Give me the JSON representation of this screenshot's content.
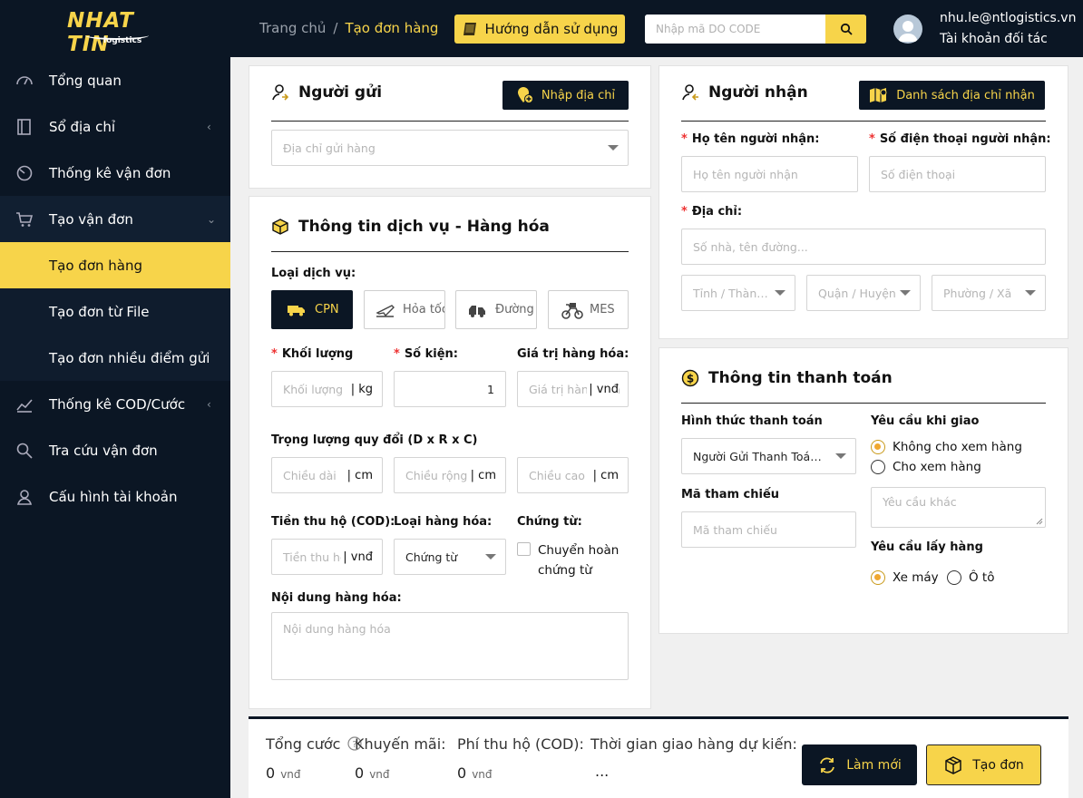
{
  "logo": {
    "brand": "NHAT TIN",
    "sub": "logistics"
  },
  "breadcrumb": {
    "home": "Trang chủ",
    "sep": "/",
    "current": "Tạo đơn hàng"
  },
  "header": {
    "guide_label": "Hướng dẫn sử dụng",
    "search_placeholder": "Nhập mã DO CODE",
    "user_email": "nhu.le@ntlogistics.vn",
    "user_role": "Tài khoản đối tác"
  },
  "sidebar": {
    "items": [
      {
        "label": "Tổng quan",
        "icon": "dashboard-icon"
      },
      {
        "label": "Sổ địa chỉ",
        "icon": "address-book-icon",
        "chevron": "‹"
      },
      {
        "label": "Thống kê vận đơn",
        "icon": "stats-icon"
      },
      {
        "label": "Tạo vận đơn",
        "icon": "cart-icon",
        "chevron": "⌄"
      },
      {
        "label": "Tạo đơn hàng"
      },
      {
        "label": "Tạo đơn từ File"
      },
      {
        "label": "Tạo đơn nhiều điểm gửi"
      },
      {
        "label": "Thống kê COD/Cước",
        "icon": "chart-icon",
        "chevron": "‹"
      },
      {
        "label": "Tra cứu vận đơn",
        "icon": "search-icon"
      },
      {
        "label": "Cấu hình tài khoản",
        "icon": "user-icon"
      }
    ]
  },
  "sender": {
    "title": "Người gửi",
    "button": "Nhập địa chỉ",
    "address_placeholder": "Địa chỉ gửi hàng"
  },
  "service": {
    "title": "Thông tin dịch vụ - Hàng hóa",
    "type_label": "Loại dịch vụ:",
    "options": [
      "CPN",
      "Hỏa tốc",
      "Đường bộ",
      "MES"
    ],
    "weight_label": "Khối lượng",
    "weight_placeholder": "Khối lượng",
    "weight_unit": "| kg",
    "packages_label": "Số kiện:",
    "packages_value": "1",
    "goods_value_label": "Giá trị hàng hóa:",
    "goods_value_placeholder": "Giá trị hàng hóa",
    "currency_unit": "| vnđ",
    "dim_label": "Trọng lượng quy đổi (D x R x C)",
    "length_placeholder": "Chiều dài",
    "width_placeholder": "Chiều rộng",
    "height_placeholder": "Chiều cao",
    "cm_unit": "| cm",
    "cod_label": "Tiền thu hộ (COD):",
    "cod_placeholder": "Tiền thu hộ",
    "goods_type_label": "Loại hàng hóa:",
    "goods_type_value": "Chứng từ",
    "docs_label": "Chứng từ:",
    "docs_check": "Chuyển hoàn chứng từ",
    "content_label": "Nội dung hàng hóa:",
    "content_placeholder": "Nội dung hàng hóa"
  },
  "receiver": {
    "title": "Người nhận",
    "button": "Danh sách địa chỉ nhận",
    "name_label": "Họ tên người nhận:",
    "name_placeholder": "Họ tên người nhận",
    "phone_label": "Số điện thoại người nhận:",
    "phone_placeholder": "Số điện thoại",
    "address_label": "Địa chỉ:",
    "address_placeholder": "Số nhà, tên đường...",
    "province": "Tỉnh / Thành phố",
    "district": "Quận / Huyện",
    "ward": "Phường / Xã"
  },
  "payment": {
    "title": "Thông tin thanh toán",
    "method_label": "Hình thức thanh toán",
    "method_value": "Người Gửi Thanh Toán Ngay",
    "ref_label": "Mã tham chiếu",
    "ref_placeholder": "Mã tham chiếu",
    "delivery_label": "Yêu cầu khi giao",
    "delivery_opt1": "Không cho xem hàng",
    "delivery_opt2": "Cho xem hàng",
    "other_placeholder": "Yêu cầu khác",
    "pickup_label": "Yêu cầu lấy hàng",
    "pickup_opt1": "Xe máy",
    "pickup_opt2": "Ô tô"
  },
  "footer": {
    "total_label": "Tổng cước",
    "total_value": "0",
    "promo_label": "Khuyến mãi:",
    "promo_value": "0",
    "cod_fee_label": "Phí thu hộ (COD):",
    "cod_fee_value": "0",
    "currency": "vnđ",
    "eta_label": "Thời gian giao hàng dự kiến:",
    "eta_value": "...",
    "reset_button": "Làm mới",
    "create_button": "Tạo đơn"
  },
  "colors": {
    "brand_dark": "#0b1624",
    "accent": "#f7d44a"
  }
}
